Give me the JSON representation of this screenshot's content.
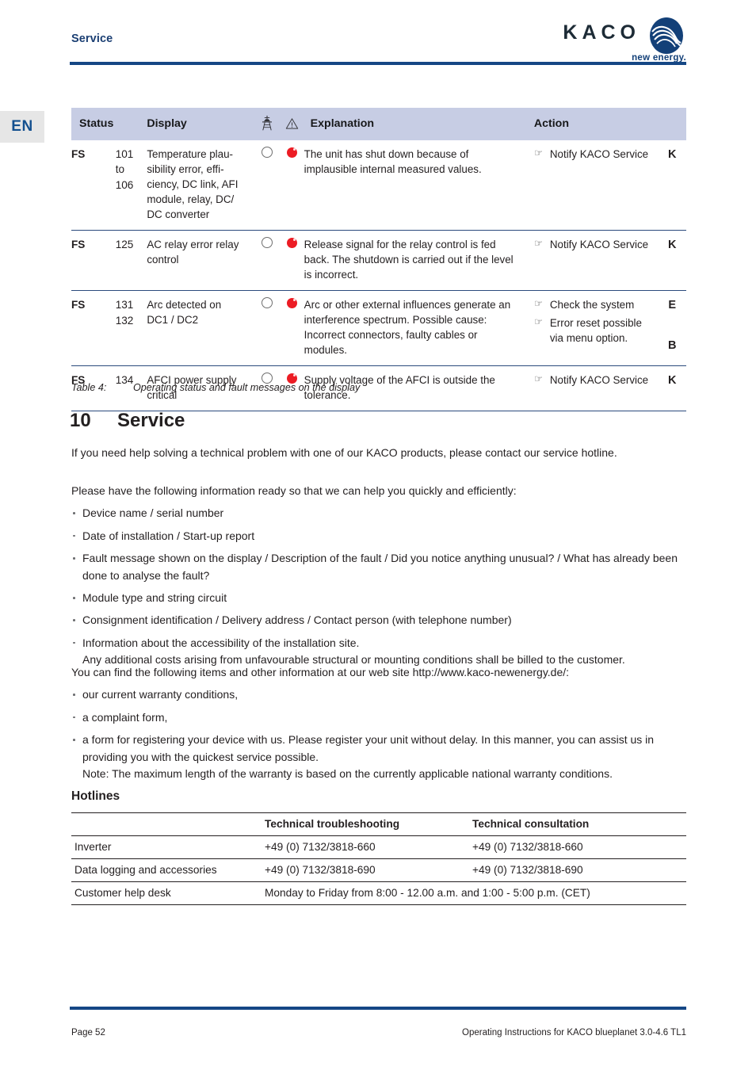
{
  "header": {
    "section_label": "Service",
    "brand_wordmark": "KACO",
    "brand_tagline": "new energy.",
    "brand_color": "#134078",
    "rule_color": "#154785"
  },
  "language_tab": {
    "label": "EN"
  },
  "status_table": {
    "columns": {
      "status": "Status",
      "number": "",
      "display": "Display",
      "grid_icon": "power-pylon-icon",
      "fault_icon": "warning-triangle-icon",
      "explanation": "Explanation",
      "action": "Action",
      "code": ""
    },
    "accent_header_bg": "#c7cde4",
    "led_red": "#ec1c24",
    "rows": [
      {
        "status": "FS",
        "number": "101\nto\n106",
        "display": "Temperature plau-sibility error, effi-ciency, DC link, AFI module, relay, DC/DC converter",
        "display_lines": [
          "Temperature plau-",
          "sibility error, effi-",
          "ciency, DC link, AFI",
          "module, relay, DC/",
          "DC converter"
        ],
        "grid_led": "off",
        "fault_led": "red",
        "explanation": "The unit has shut down because of implausible internal measured values.",
        "actions": [
          "Notify KACO Service"
        ],
        "codes": [
          "K"
        ]
      },
      {
        "status": "FS",
        "number": "125",
        "display": "AC relay error relay control",
        "display_lines": [
          "AC relay error relay",
          "control"
        ],
        "grid_led": "off",
        "fault_led": "red",
        "explanation": "Release signal for the relay control is fed back. The shutdown is carried out if the level is incorrect.",
        "actions": [
          "Notify KACO Service"
        ],
        "codes": [
          "K"
        ]
      },
      {
        "status": "FS",
        "number": "131\n132",
        "display": "Arc detected on DC1 / DC2",
        "display_lines": [
          "Arc detected on",
          "DC1 / DC2"
        ],
        "grid_led": "off",
        "fault_led": "red",
        "explanation": "Arc or other external influences generate an interference spectrum. Possible cause: Incorrect connectors, faulty cables or modules.",
        "actions": [
          "Check the system",
          "Error reset possible via menu option."
        ],
        "codes": [
          "E",
          "B"
        ]
      },
      {
        "status": "FS",
        "number": "134",
        "display": "AFCI power supply critical",
        "display_lines": [
          "AFCI power supply",
          "critical"
        ],
        "grid_led": "off",
        "fault_led": "red",
        "explanation": "Supply voltage of the AFCI is outside the tolerance.",
        "actions": [
          "Notify KACO Service"
        ],
        "codes": [
          "K"
        ]
      }
    ]
  },
  "table_caption": {
    "label": "Table 4:",
    "text": "Operating status and fault messages on the display"
  },
  "section": {
    "number": "10",
    "title": "Service"
  },
  "body": {
    "intro": "If you need help solving a technical problem with one of our KACO products, please contact our service hotline.",
    "prepare_lead": "Please have the following information ready so that we can help you quickly and efficiently:",
    "prepare_items": [
      {
        "text": "Device name / serial number",
        "sub": ""
      },
      {
        "text": "Date of installation / Start-up report",
        "sub": ""
      },
      {
        "text": "Fault message shown on the display / Description of the fault / Did you notice anything unusual? / What has already been done to analyse the fault?",
        "sub": ""
      },
      {
        "text": "Module type and string circuit",
        "sub": ""
      },
      {
        "text": "Consignment identification / Delivery address / Contact person (with telephone number)",
        "sub": ""
      },
      {
        "text": "Information about the accessibility of the installation site.",
        "sub": "Any additional costs arising from unfavourable structural or mounting conditions shall be billed to the customer."
      }
    ],
    "website_lead": "You can find the following items and other information at our web site http://www.kaco-newenergy.de/:",
    "website_items": [
      {
        "text": "our current warranty conditions,",
        "sub": ""
      },
      {
        "text": "a complaint form,",
        "sub": ""
      },
      {
        "text": "a form for registering your device with us. Please register your unit without delay. In this manner, you can assist us in providing you with the quickest service possible.",
        "sub": "Note: The maximum length of the warranty is based on the currently applicable national warranty conditions."
      }
    ]
  },
  "hotlines": {
    "heading": "Hotlines",
    "columns": {
      "label": "",
      "troubleshooting": "Technical troubleshooting",
      "consultation": "Technical consultation"
    },
    "rows": [
      {
        "label": "Inverter",
        "troubleshooting": "+49 (0) 7132/3818-660",
        "consultation": "+49 (0) 7132/3818-660",
        "span": false
      },
      {
        "label": "Data logging and accessories",
        "troubleshooting": "+49 (0) 7132/3818-690",
        "consultation": "+49 (0) 7132/3818-690",
        "span": false
      },
      {
        "label": "Customer help desk",
        "troubleshooting": "Monday to Friday from 8:00 - 12.00 a.m. and 1:00 - 5:00 p.m. (CET)",
        "consultation": "",
        "span": true
      }
    ]
  },
  "footer": {
    "page": "Page 52",
    "document": "Operating Instructions for KACO blueplanet 3.0-4.6 TL1"
  }
}
